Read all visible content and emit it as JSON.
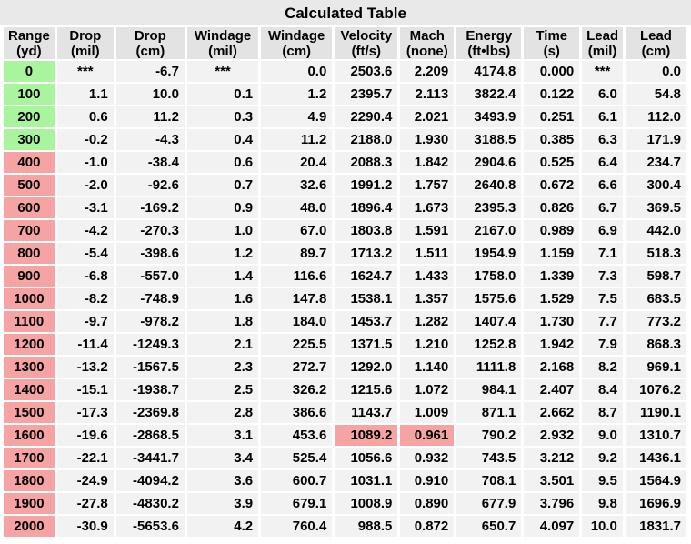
{
  "title": "Calculated Table",
  "headers": [
    [
      "Range",
      "(yd)"
    ],
    [
      "Drop",
      "(mil)"
    ],
    [
      "Drop",
      "(cm)"
    ],
    [
      "Windage",
      "(mil)"
    ],
    [
      "Windage",
      "(cm)"
    ],
    [
      "Velocity",
      "(ft/s)"
    ],
    [
      "Mach",
      "(none)"
    ],
    [
      "Energy",
      "(ft•lbs)"
    ],
    [
      "Time",
      "(s)"
    ],
    [
      "Lead",
      "(mil)"
    ],
    [
      "Lead",
      "(cm)"
    ]
  ],
  "colors": {
    "in_range": "#a8f59d",
    "out_of_range": "#f5a3a3",
    "subsonic": "#f5a3a3"
  },
  "rows": [
    [
      "0",
      "***",
      "-6.7",
      "***",
      "0.0",
      "2503.6",
      "2.209",
      "4174.8",
      "0.000",
      "***",
      "0.0"
    ],
    [
      "100",
      "1.1",
      "10.0",
      "0.1",
      "1.2",
      "2395.7",
      "2.113",
      "3822.4",
      "0.122",
      "6.0",
      "54.8"
    ],
    [
      "200",
      "0.6",
      "11.2",
      "0.3",
      "4.9",
      "2290.4",
      "2.021",
      "3493.9",
      "0.251",
      "6.1",
      "112.0"
    ],
    [
      "300",
      "-0.2",
      "-4.3",
      "0.4",
      "11.2",
      "2188.0",
      "1.930",
      "3188.5",
      "0.385",
      "6.3",
      "171.9"
    ],
    [
      "400",
      "-1.0",
      "-38.4",
      "0.6",
      "20.4",
      "2088.3",
      "1.842",
      "2904.6",
      "0.525",
      "6.4",
      "234.7"
    ],
    [
      "500",
      "-2.0",
      "-92.6",
      "0.7",
      "32.6",
      "1991.2",
      "1.757",
      "2640.8",
      "0.672",
      "6.6",
      "300.4"
    ],
    [
      "600",
      "-3.1",
      "-169.2",
      "0.9",
      "48.0",
      "1896.4",
      "1.673",
      "2395.3",
      "0.826",
      "6.7",
      "369.5"
    ],
    [
      "700",
      "-4.2",
      "-270.3",
      "1.0",
      "67.0",
      "1803.8",
      "1.591",
      "2167.0",
      "0.989",
      "6.9",
      "442.0"
    ],
    [
      "800",
      "-5.4",
      "-398.6",
      "1.2",
      "89.7",
      "1713.2",
      "1.511",
      "1954.9",
      "1.159",
      "7.1",
      "518.3"
    ],
    [
      "900",
      "-6.8",
      "-557.0",
      "1.4",
      "116.6",
      "1624.7",
      "1.433",
      "1758.0",
      "1.339",
      "7.3",
      "598.7"
    ],
    [
      "1000",
      "-8.2",
      "-748.9",
      "1.6",
      "147.8",
      "1538.1",
      "1.357",
      "1575.6",
      "1.529",
      "7.5",
      "683.5"
    ],
    [
      "1100",
      "-9.7",
      "-978.2",
      "1.8",
      "184.0",
      "1453.7",
      "1.282",
      "1407.4",
      "1.730",
      "7.7",
      "773.2"
    ],
    [
      "1200",
      "-11.4",
      "-1249.3",
      "2.1",
      "225.5",
      "1371.5",
      "1.210",
      "1252.8",
      "1.942",
      "7.9",
      "868.3"
    ],
    [
      "1300",
      "-13.2",
      "-1567.5",
      "2.3",
      "272.7",
      "1292.0",
      "1.140",
      "1111.8",
      "2.168",
      "8.2",
      "969.1"
    ],
    [
      "1400",
      "-15.1",
      "-1938.7",
      "2.5",
      "326.2",
      "1215.6",
      "1.072",
      "984.1",
      "2.407",
      "8.4",
      "1076.2"
    ],
    [
      "1500",
      "-17.3",
      "-2369.8",
      "2.8",
      "386.6",
      "1143.7",
      "1.009",
      "871.1",
      "2.662",
      "8.7",
      "1190.1"
    ],
    [
      "1600",
      "-19.6",
      "-2868.5",
      "3.1",
      "453.6",
      "1089.2",
      "0.961",
      "790.2",
      "2.932",
      "9.0",
      "1310.7"
    ],
    [
      "1700",
      "-22.1",
      "-3441.7",
      "3.4",
      "525.4",
      "1056.6",
      "0.932",
      "743.5",
      "3.212",
      "9.2",
      "1436.1"
    ],
    [
      "1800",
      "-24.9",
      "-4094.2",
      "3.6",
      "600.7",
      "1031.1",
      "0.910",
      "708.1",
      "3.501",
      "9.5",
      "1564.9"
    ],
    [
      "1900",
      "-27.8",
      "-4830.2",
      "3.9",
      "679.1",
      "1008.9",
      "0.890",
      "677.9",
      "3.796",
      "9.8",
      "1696.9"
    ],
    [
      "2000",
      "-30.9",
      "-5653.6",
      "4.2",
      "760.4",
      "988.5",
      "0.872",
      "650.7",
      "4.097",
      "10.0",
      "1831.7"
    ]
  ],
  "green_rows": [
    0,
    1,
    2,
    3
  ],
  "highlighted_cells": [
    [
      16,
      5
    ],
    [
      16,
      6
    ]
  ]
}
